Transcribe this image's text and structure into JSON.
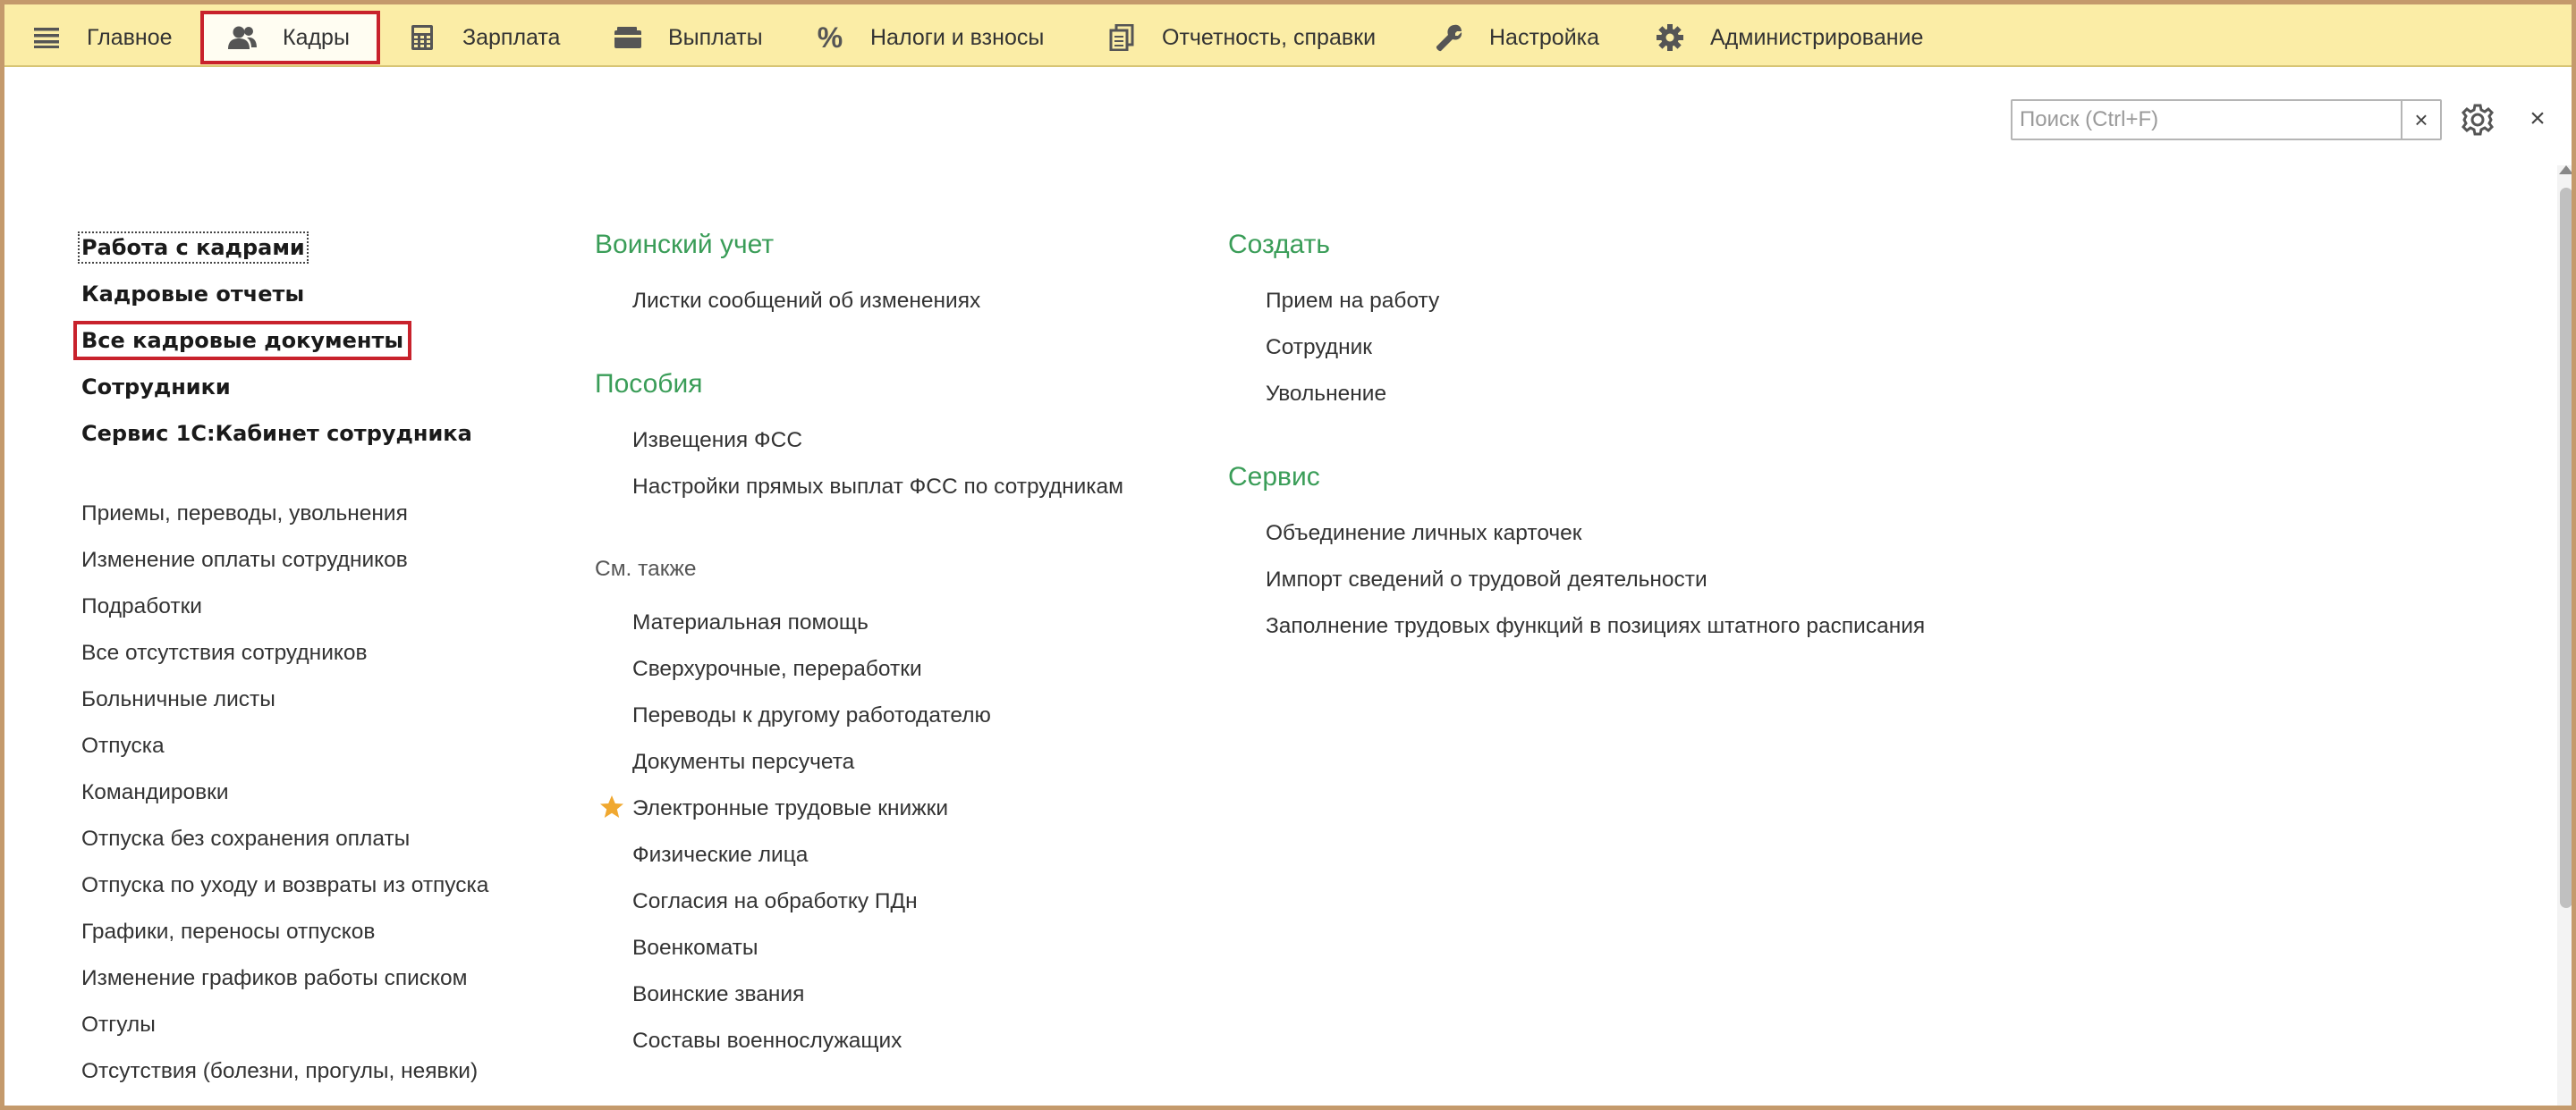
{
  "topbar": {
    "tabs": [
      {
        "label": "Главное",
        "icon": "menu-icon"
      },
      {
        "label": "Кадры",
        "icon": "users-icon",
        "selected": true
      },
      {
        "label": "Зарплата",
        "icon": "calculator-icon"
      },
      {
        "label": "Выплаты",
        "icon": "wallet-icon"
      },
      {
        "label": "Налоги и взносы",
        "icon": "percent-icon"
      },
      {
        "label": "Отчетность, справки",
        "icon": "documents-icon"
      },
      {
        "label": "Настройка",
        "icon": "wrench-icon"
      },
      {
        "label": "Администрирование",
        "icon": "gear-icon"
      }
    ]
  },
  "search": {
    "placeholder": "Поиск (Ctrl+F)",
    "clear": "×"
  },
  "close_label": "×",
  "colors": {
    "topbar": "#fbeda6",
    "selection": "#c8222c",
    "group_header": "#3a9d58",
    "frame": "#c49a6c",
    "star": "#f0a830"
  },
  "left_column": {
    "primary": [
      "Работа с кадрами",
      "Кадровые отчеты",
      "Все кадровые документы",
      "Сотрудники",
      "Сервис 1С:Кабинет сотрудника"
    ],
    "items": [
      "Приемы, переводы, увольнения",
      "Изменение оплаты сотрудников",
      "Подработки",
      "Все отсутствия сотрудников",
      "Больничные листы",
      "Отпуска",
      "Командировки",
      "Отпуска без сохранения оплаты",
      "Отпуска по уходу и возвраты из отпуска",
      "Графики, переносы отпусков",
      "Изменение графиков работы списком",
      "Отгулы",
      "Отсутствия (болезни, прогулы, неявки)"
    ]
  },
  "middle_column": {
    "groups": [
      {
        "title": "Воинский учет",
        "items": [
          "Листки сообщений об изменениях"
        ]
      },
      {
        "title": "Пособия",
        "items": [
          "Извещения ФСС",
          "Настройки прямых выплат ФСС по сотрудникам"
        ]
      }
    ],
    "see_also": {
      "title": "См. также",
      "items": [
        "Материальная помощь",
        "Сверхурочные, переработки",
        "Переводы к другому работодателю",
        "Документы персучета",
        "Электронные трудовые книжки",
        "Физические лица",
        "Согласия на обработку ПДн",
        "Военкоматы",
        "Воинские звания",
        "Составы военнослужащих"
      ]
    }
  },
  "right_column": {
    "groups": [
      {
        "title": "Создать",
        "items": [
          "Прием на работу",
          "Сотрудник",
          "Увольнение"
        ]
      },
      {
        "title": "Сервис",
        "items": [
          "Объединение личных карточек",
          "Импорт сведений о трудовой деятельности",
          "Заполнение трудовых функций в позициях штатного расписания"
        ]
      }
    ]
  }
}
